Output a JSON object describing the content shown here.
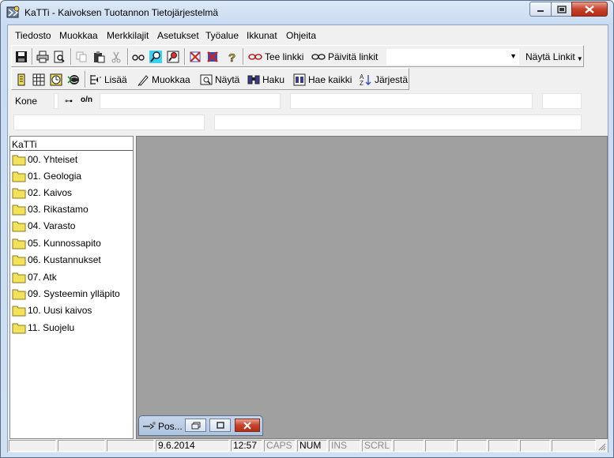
{
  "window": {
    "title": "KaTTi - Kaivoksen Tuotannon Tietojärjestelmä"
  },
  "menu": [
    "Tiedosto",
    "Muokkaa",
    "Merkkilajit",
    "Asetukset",
    "Työalue",
    "Ikkunat",
    "Ohjeita"
  ],
  "toolbar1": {
    "tee_linkki": "Tee linkki",
    "paivita_linkit": "Päivitä linkit",
    "combo_value": "",
    "nayta_linkit": "Näytä Linkit"
  },
  "toolbar2": {
    "lisaa": "Lisää",
    "muokkaa": "Muokkaa",
    "nayta": "Näytä",
    "haku": "Haku",
    "hae_kaikki": "Hae kaikki",
    "jarjesta": "Järjestä"
  },
  "fields": {
    "kone_label": "Kone",
    "key_label": "o/n"
  },
  "tree": {
    "header": "KaTTi",
    "items": [
      "00. Yhteiset",
      "01. Geologia",
      "02. Kaivos",
      "03. Rikastamo",
      "04. Varasto",
      "05. Kunnossapito",
      "06. Kustannukset",
      "07. Atk",
      "09. Systeemin ylläpito",
      "10. Uusi kaivos",
      "11. Suojelu"
    ]
  },
  "minimized_window": {
    "title": "Pos..."
  },
  "statusbar": {
    "date": "9.6.2014",
    "time": "12:57",
    "caps": "CAPS",
    "num": "NUM",
    "ins": "INS",
    "scrl": "SCRL"
  },
  "colors": {
    "folder": "#f2e25a",
    "mdi_background": "#a0a0a0",
    "close_button": "#c7432b"
  }
}
